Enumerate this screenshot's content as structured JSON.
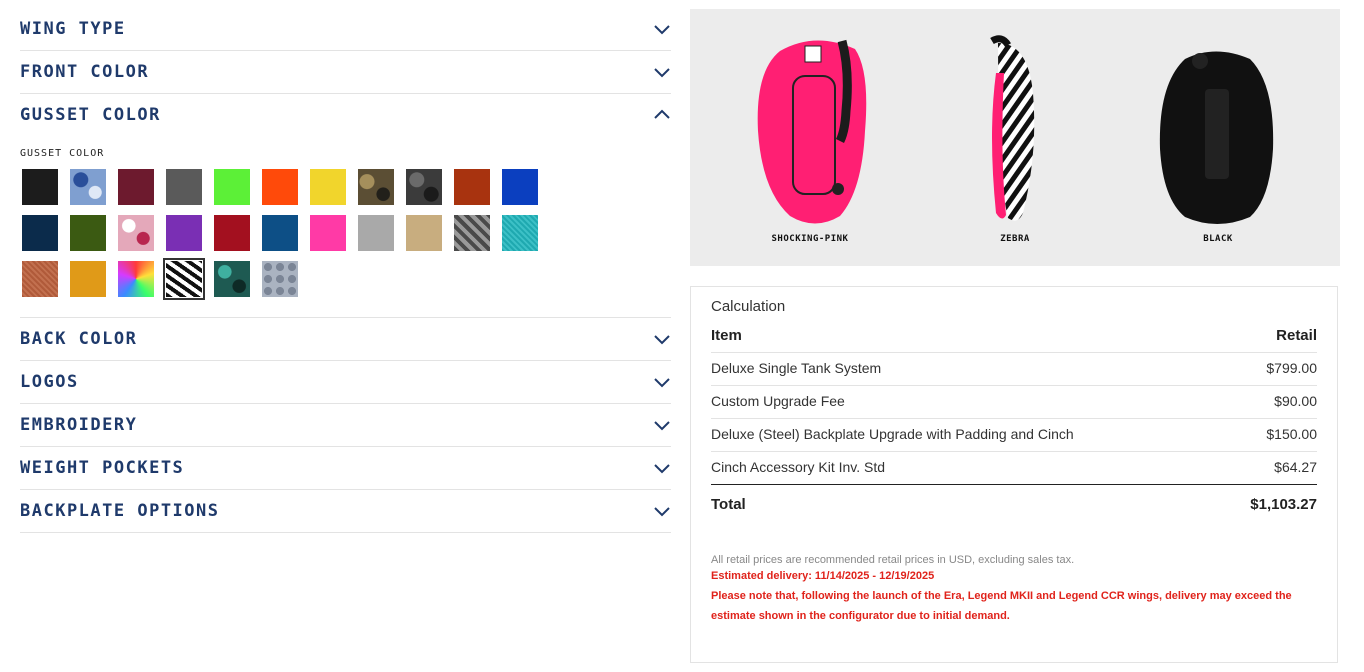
{
  "accordion": {
    "wing_type": "WING TYPE",
    "front_color": "FRONT COLOR",
    "gusset_color": "GUSSET COLOR",
    "back_color": "BACK COLOR",
    "logos": "LOGOS",
    "embroidery": "EMBROIDERY",
    "weight_pockets": "WEIGHT POCKETS",
    "backplate_options": "BACKPLATE OPTIONS"
  },
  "gusset": {
    "label": "GUSSET COLOR",
    "selected": "zebra",
    "swatches": [
      {
        "name": "black",
        "color": "#1c1c1c"
      },
      {
        "name": "blue-camo",
        "color": "#7f9fd0"
      },
      {
        "name": "burgundy",
        "color": "#6d1a2e"
      },
      {
        "name": "grey",
        "color": "#5a5a5a"
      },
      {
        "name": "lime-green",
        "color": "#5cf037"
      },
      {
        "name": "orange",
        "color": "#ff4a0a"
      },
      {
        "name": "yellow",
        "color": "#f1d52c"
      },
      {
        "name": "desert-camo",
        "color": "#5b4e34"
      },
      {
        "name": "dark-camo",
        "color": "#3b3b3b"
      },
      {
        "name": "rust",
        "color": "#a8330f"
      },
      {
        "name": "royal-blue",
        "color": "#0b3fbf"
      },
      {
        "name": "navy",
        "color": "#0b2b4b"
      },
      {
        "name": "olive",
        "color": "#3b5a12"
      },
      {
        "name": "pink-camo",
        "color": "#e4a8ba"
      },
      {
        "name": "purple",
        "color": "#7a2fb4"
      },
      {
        "name": "red",
        "color": "#a3101f"
      },
      {
        "name": "ocean-blue",
        "color": "#0d4f86"
      },
      {
        "name": "hot-pink",
        "color": "#ff3aa6"
      },
      {
        "name": "light-grey",
        "color": "#a9a9a9"
      },
      {
        "name": "tan",
        "color": "#c8ad7f"
      },
      {
        "name": "digital-camo",
        "color": "#6f6f6f"
      },
      {
        "name": "teal",
        "color": "#1fa9b0"
      },
      {
        "name": "copper",
        "color": "#b05a3a"
      },
      {
        "name": "gold",
        "color": "#e09a18"
      },
      {
        "name": "tie-dye",
        "color": "#d64bb0"
      },
      {
        "name": "zebra",
        "color": "#ffffff"
      },
      {
        "name": "teal-camo",
        "color": "#1e5a52"
      },
      {
        "name": "hex-grey",
        "color": "#8a94a4"
      }
    ]
  },
  "preview": {
    "front_label": "SHOCKING-PINK",
    "gusset_label": "ZEBRA",
    "back_label": "BLACK"
  },
  "calc": {
    "title": "Calculation",
    "col_item": "Item",
    "col_retail": "Retail",
    "rows": [
      {
        "name": "Deluxe Single Tank System",
        "price": "$799.00"
      },
      {
        "name": "Custom Upgrade Fee",
        "price": "$90.00"
      },
      {
        "name": "Deluxe (Steel) Backplate Upgrade with Padding and Cinch",
        "price": "$150.00"
      },
      {
        "name": "Cinch Accessory Kit Inv. Std",
        "price": "$64.27"
      }
    ],
    "total_label": "Total",
    "total_value": "$1,103.27",
    "note": "All retail prices are recommended retail prices in USD, excluding sales tax.",
    "delivery": "Estimated delivery: 11/14/2025 - 12/19/2025",
    "warning": "Please note that, following the launch of the Era, Legend MKII and Legend CCR wings, delivery may exceed the estimate shown in the configurator due to initial demand."
  },
  "colors": {
    "heading": "#1f3a6b",
    "warning": "#e0231b",
    "wing_pink": "#ff1f73"
  }
}
